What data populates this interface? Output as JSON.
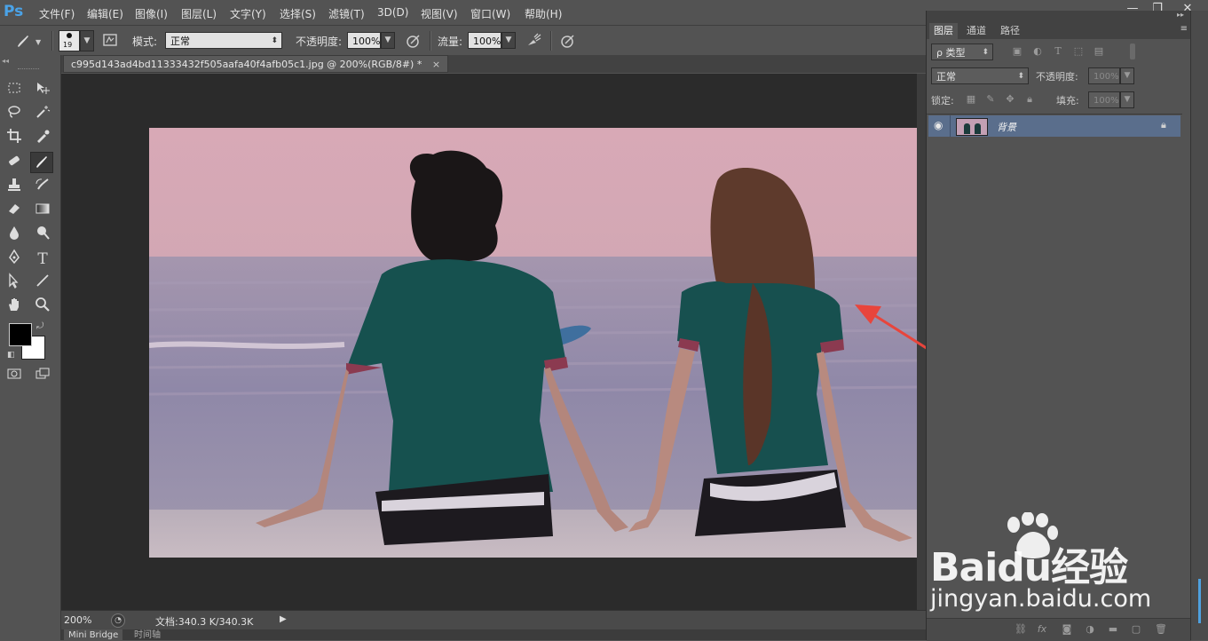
{
  "app": {
    "logo": "Ps"
  },
  "menu": [
    "文件(F)",
    "编辑(E)",
    "图像(I)",
    "图层(L)",
    "文字(Y)",
    "选择(S)",
    "滤镜(T)",
    "3D(D)",
    "视图(V)",
    "窗口(W)",
    "帮助(H)"
  ],
  "window_controls": {
    "minimize": "—",
    "restore": "❐",
    "close": "✕"
  },
  "options": {
    "brush_size": "19",
    "mode_label": "模式:",
    "mode_value": "正常",
    "opacity_label": "不透明度:",
    "opacity_value": "100%",
    "flow_label": "流量:",
    "flow_value": "100%"
  },
  "document": {
    "tab_title": "c995d143ad4bd11333432f505aafa40f4afb05c1.jpg @ 200%(RGB/8#) *",
    "zoom": "200%",
    "doc_size": "文档:340.3 K/340.3K"
  },
  "bottom_tabs": [
    "Mini Bridge",
    "时间轴"
  ],
  "panels": {
    "tabs": [
      "图层",
      "通道",
      "路径"
    ],
    "filter_kind": "ρ 类型",
    "blend_mode": "正常",
    "opacity_label": "不透明度:",
    "opacity_value": "100%",
    "lock_label": "锁定:",
    "fill_label": "填充:",
    "fill_value": "100%",
    "layers": [
      {
        "name": "背景"
      }
    ]
  },
  "watermark": {
    "brand": "Baidu经验",
    "url": "jingyan.baidu.com"
  },
  "colors": {
    "accent": "#4aa3e8",
    "selected_layer": "#5a6e8c",
    "arrow": "#e8453c"
  }
}
